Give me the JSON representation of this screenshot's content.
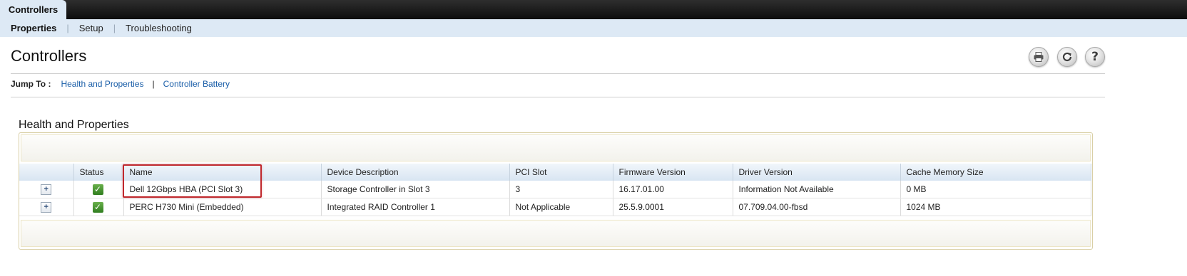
{
  "top_tab": {
    "label": "Controllers"
  },
  "subnav": {
    "items": [
      "Properties",
      "Setup",
      "Troubleshooting"
    ]
  },
  "page": {
    "title": "Controllers"
  },
  "toolbar": {
    "icons": [
      "print-icon",
      "refresh-icon",
      "help-icon"
    ]
  },
  "jump_to": {
    "label": "Jump To :",
    "links": [
      "Health and Properties",
      "Controller Battery"
    ]
  },
  "section": {
    "title": "Health and Properties",
    "columns": [
      "",
      "Status",
      "Name",
      "Device Description",
      "PCI Slot",
      "Firmware Version",
      "Driver Version",
      "Cache Memory Size"
    ],
    "rows": [
      {
        "expand": "+",
        "status": "ok",
        "name": "Dell 12Gbps HBA (PCI Slot 3)",
        "description": "Storage Controller in Slot 3",
        "pci_slot": "3",
        "firmware": "16.17.01.00",
        "driver": "Information Not Available",
        "cache": "0 MB"
      },
      {
        "expand": "+",
        "status": "ok",
        "name": "PERC H730 Mini (Embedded)",
        "description": "Integrated RAID Controller 1",
        "pci_slot": "Not Applicable",
        "firmware": "25.5.9.0001",
        "driver": "07.709.04.00-fbsd",
        "cache": "1024 MB"
      }
    ]
  },
  "colors": {
    "accent_link": "#1a5ea8",
    "highlight_border": "#c0282d",
    "status_ok": "#3f8f2a",
    "subnav_bg": "#dde9f5"
  }
}
